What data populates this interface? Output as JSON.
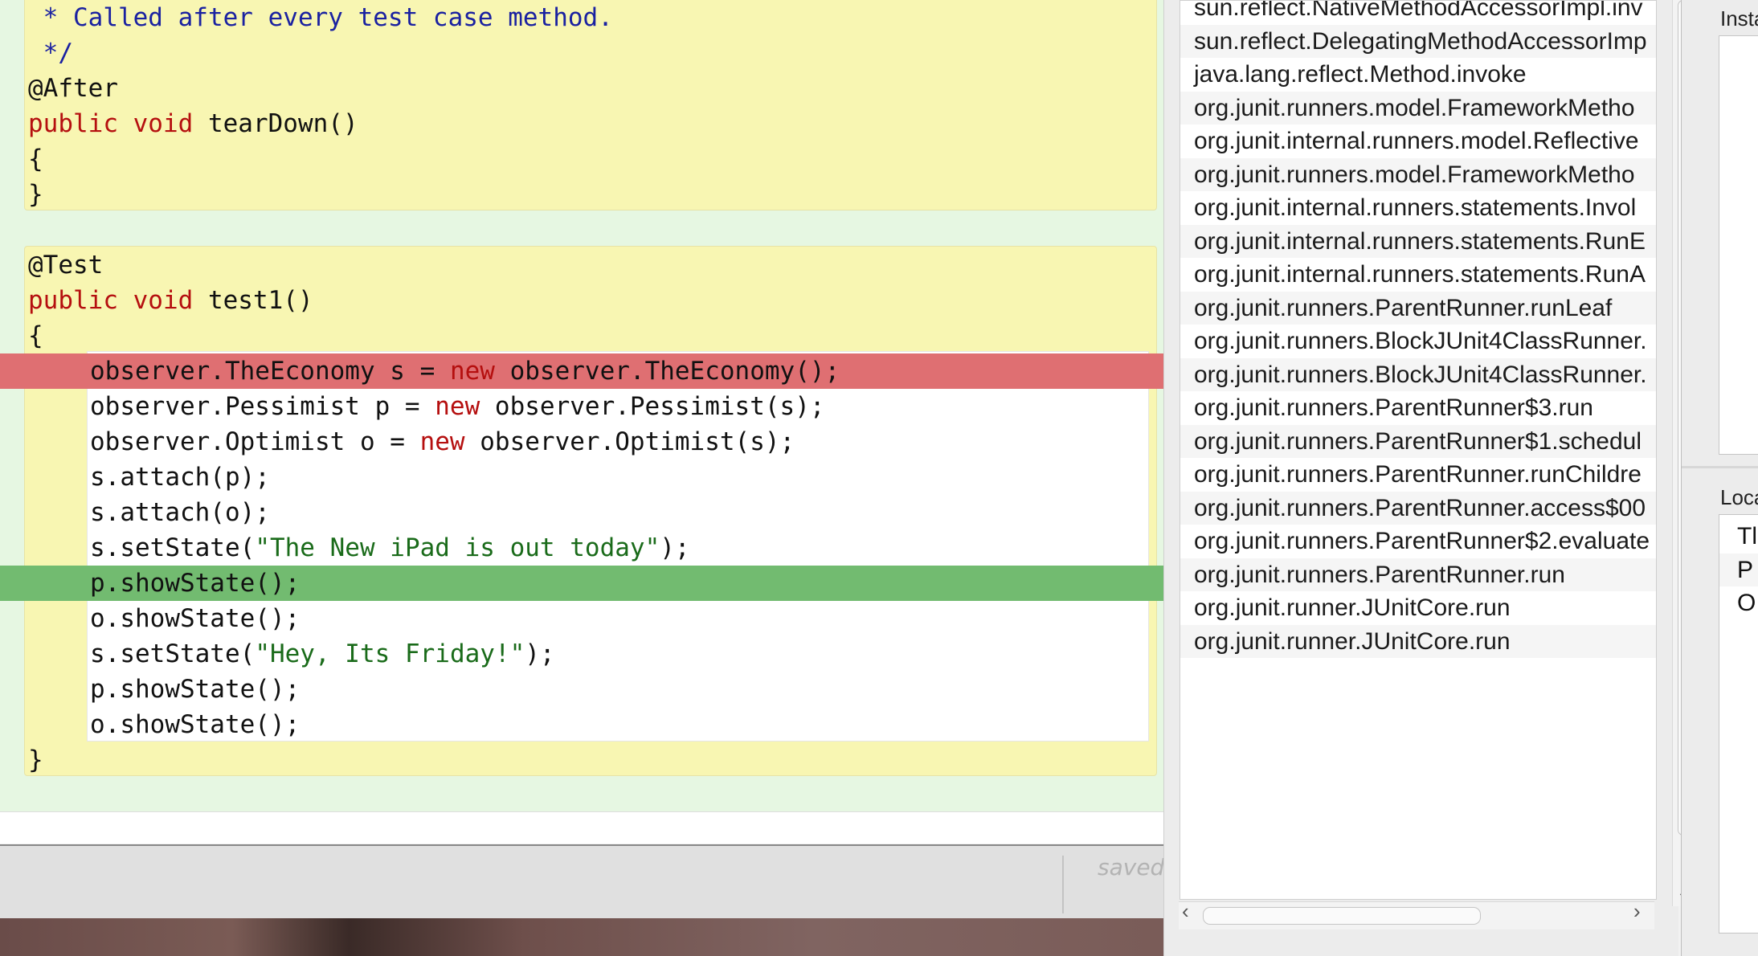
{
  "editor": {
    "lines": [
      {
        "indent": false,
        "hl": "",
        "parts": [
          {
            "c": "cm",
            "t": " * Called after every test case method."
          }
        ]
      },
      {
        "indent": false,
        "hl": "",
        "parts": [
          {
            "c": "cm",
            "t": " */"
          }
        ]
      },
      {
        "indent": false,
        "hl": "",
        "parts": [
          {
            "c": "",
            "t": "@After"
          }
        ]
      },
      {
        "indent": false,
        "hl": "",
        "parts": [
          {
            "c": "kw",
            "t": "public void "
          },
          {
            "c": "",
            "t": "tearDown()"
          }
        ]
      },
      {
        "indent": false,
        "hl": "",
        "parts": [
          {
            "c": "",
            "t": "{"
          }
        ]
      },
      {
        "indent": false,
        "hl": "",
        "parts": [
          {
            "c": "",
            "t": "}"
          }
        ]
      },
      {
        "indent": false,
        "hl": "",
        "parts": [
          {
            "c": "",
            "t": ""
          }
        ]
      },
      {
        "indent": false,
        "hl": "",
        "parts": [
          {
            "c": "",
            "t": "@Test"
          }
        ]
      },
      {
        "indent": false,
        "hl": "",
        "parts": [
          {
            "c": "kw",
            "t": "public void "
          },
          {
            "c": "",
            "t": "test1()"
          }
        ]
      },
      {
        "indent": false,
        "hl": "",
        "parts": [
          {
            "c": "",
            "t": "{"
          }
        ]
      },
      {
        "indent": true,
        "hl": "red",
        "parts": [
          {
            "c": "",
            "t": "observer.TheEconomy s = "
          },
          {
            "c": "kw",
            "t": "new "
          },
          {
            "c": "",
            "t": "observer.TheEconomy();"
          }
        ]
      },
      {
        "indent": true,
        "hl": "",
        "parts": [
          {
            "c": "",
            "t": "observer.Pessimist p = "
          },
          {
            "c": "kw",
            "t": "new "
          },
          {
            "c": "",
            "t": "observer.Pessimist(s);"
          }
        ]
      },
      {
        "indent": true,
        "hl": "",
        "parts": [
          {
            "c": "",
            "t": "observer.Optimist o = "
          },
          {
            "c": "kw",
            "t": "new "
          },
          {
            "c": "",
            "t": "observer.Optimist(s);"
          }
        ]
      },
      {
        "indent": true,
        "hl": "",
        "parts": [
          {
            "c": "",
            "t": "s.attach(p);"
          }
        ]
      },
      {
        "indent": true,
        "hl": "",
        "parts": [
          {
            "c": "",
            "t": "s.attach(o);"
          }
        ]
      },
      {
        "indent": true,
        "hl": "",
        "parts": [
          {
            "c": "",
            "t": "s.setState("
          },
          {
            "c": "str",
            "t": "\"The New iPad is out today\""
          },
          {
            "c": "",
            "t": ");"
          }
        ]
      },
      {
        "indent": true,
        "hl": "green",
        "parts": [
          {
            "c": "",
            "t": "p.showState();"
          }
        ]
      },
      {
        "indent": true,
        "hl": "",
        "parts": [
          {
            "c": "",
            "t": "o.showState();"
          }
        ]
      },
      {
        "indent": true,
        "hl": "",
        "parts": [
          {
            "c": "",
            "t": "s.setState("
          },
          {
            "c": "str",
            "t": "\"Hey, Its Friday!\""
          },
          {
            "c": "",
            "t": ");"
          }
        ]
      },
      {
        "indent": true,
        "hl": "",
        "parts": [
          {
            "c": "",
            "t": "p.showState();"
          }
        ]
      },
      {
        "indent": true,
        "hl": "",
        "parts": [
          {
            "c": "",
            "t": "o.showState();"
          }
        ]
      },
      {
        "indent": false,
        "hl": "",
        "parts": [
          {
            "c": "",
            "t": "}"
          }
        ]
      }
    ],
    "status": {
      "saved_label": "saved"
    }
  },
  "stack_trace": {
    "frames": [
      "sun.reflect.NativeMethodAccessorImpl.inv",
      "sun.reflect.DelegatingMethodAccessorImp",
      "java.lang.reflect.Method.invoke",
      "org.junit.runners.model.FrameworkMetho",
      "org.junit.internal.runners.model.Reflective",
      "org.junit.runners.model.FrameworkMetho",
      "org.junit.internal.runners.statements.Invol",
      "org.junit.internal.runners.statements.RunE",
      "org.junit.internal.runners.statements.RunA",
      "org.junit.runners.ParentRunner.runLeaf",
      "org.junit.runners.BlockJUnit4ClassRunner.",
      "org.junit.runners.BlockJUnit4ClassRunner.",
      "org.junit.runners.ParentRunner$3.run",
      "org.junit.runners.ParentRunner$1.schedul",
      "org.junit.runners.ParentRunner.runChildre",
      "org.junit.runners.ParentRunner.access$00",
      "org.junit.runners.ParentRunner$2.evaluate",
      "org.junit.runners.ParentRunner.run",
      "org.junit.runner.JUnitCore.run",
      "org.junit.runner.JUnitCore.run"
    ]
  },
  "variables": {
    "instance_heading": "Insta",
    "local_heading": "Loca",
    "local_items": [
      "Tl",
      "P",
      "O"
    ]
  },
  "icons": {
    "scroll_down": "chevron-down-icon",
    "scroll_left": "chevron-left-icon",
    "scroll_right": "chevron-right-icon"
  }
}
